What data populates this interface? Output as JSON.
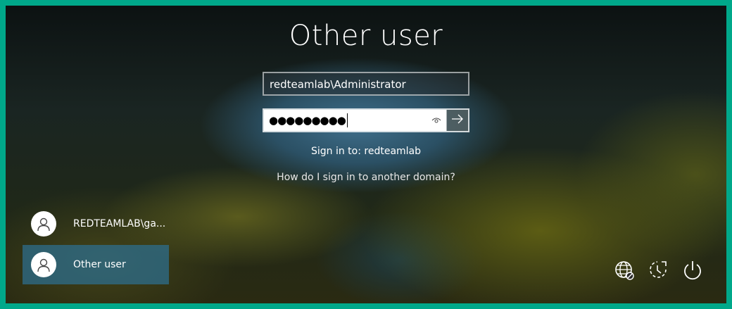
{
  "login": {
    "title": "Other user",
    "username_value": "redteamlab\\Administrator",
    "password_mask": "●●●●●●●●●",
    "sign_in_to": "Sign in to: redteamlab",
    "domain_help_link": "How do I sign in to another domain?",
    "reveal_icon": "eye-icon",
    "submit_icon": "arrow-right-icon"
  },
  "user_list": [
    {
      "name": "REDTEAMLAB\\ga...",
      "selected": false,
      "icon": "user-avatar-icon"
    },
    {
      "name": "Other user",
      "selected": true,
      "icon": "user-avatar-icon"
    }
  ],
  "system_buttons": [
    {
      "name": "network",
      "icon": "network-globe-icon"
    },
    {
      "name": "accessibility",
      "icon": "ease-of-access-icon"
    },
    {
      "name": "power",
      "icon": "power-icon"
    }
  ],
  "colors": {
    "frame_border": "#00a88a",
    "selected_tile": "#2d6e8c"
  }
}
